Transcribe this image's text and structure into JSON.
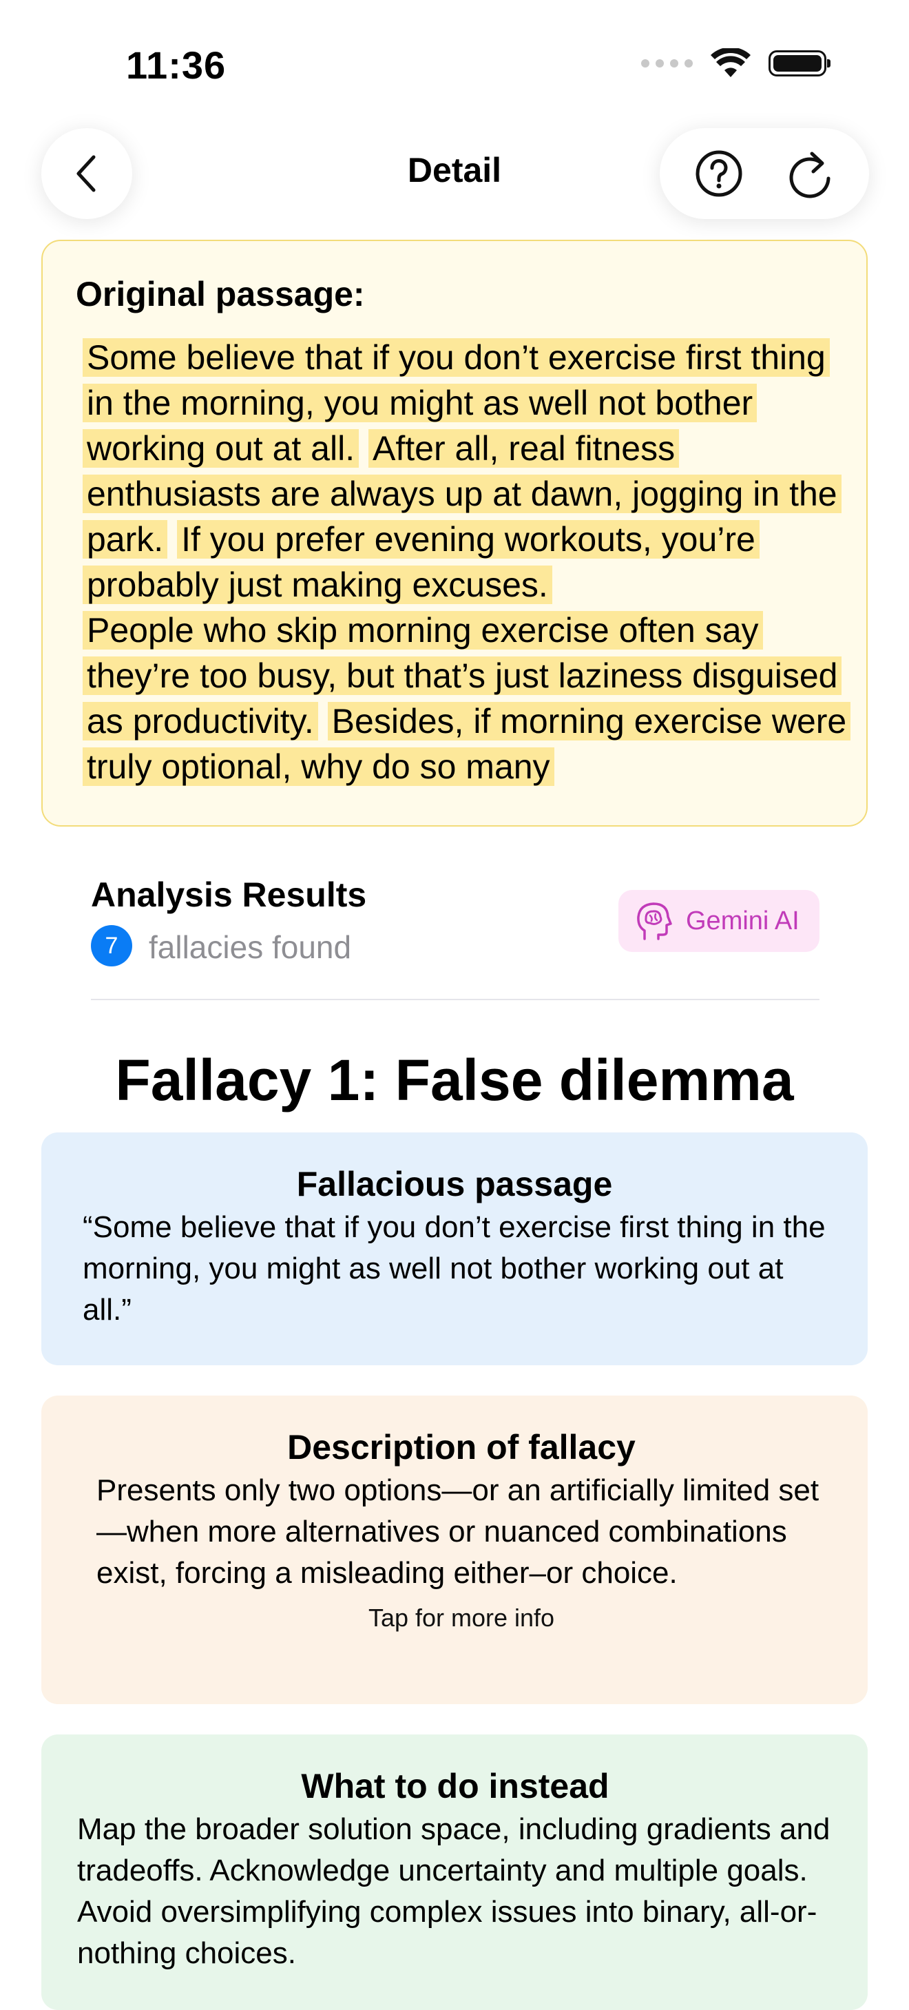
{
  "status_bar": {
    "time": "11:36"
  },
  "nav": {
    "title": "Detail"
  },
  "original": {
    "label": "Original passage:",
    "segments": [
      "Some believe that if you don’t exercise first thing in the morning, you might as well not bother working out at all.",
      "After all, real fitness enthusiasts are always up at dawn, jogging in the park.",
      "If you prefer evening workouts, you’re probably just making excuses.",
      "People who skip morning exercise often say they’re too busy, but that’s just laziness disguised as productivity.",
      "Besides, if morning exercise were truly optional, why do so many"
    ]
  },
  "analysis": {
    "title": "Analysis Results",
    "count": "7",
    "count_label": "fallacies found",
    "engine_label": "Gemini AI"
  },
  "fallacy": {
    "heading": "Fallacy 1: False dilemma",
    "passage_title": "Fallacious passage",
    "passage_text": "“Some believe that if you don’t exercise first thing in the morning, you might as well not bother working out at all.”",
    "description_title": "Description of fallacy",
    "description_text": "Presents only two options—or an artificially limited set—when more alternatives or nuanced combinations exist, forcing a misleading either–or choice.",
    "more_info": "Tap for more info",
    "instead_title": "What to do instead",
    "instead_text": "Map the broader solution space, including gradients and tradeoffs. Acknowledge uncertainty and multiple goals. Avoid oversimplifying complex issues into binary, all-or-nothing choices."
  },
  "icons": {
    "back": "chevron-left-icon",
    "help": "question-circle-icon",
    "refresh": "refresh-icon",
    "engine": "brain-head-icon"
  },
  "colors": {
    "highlight": "#fde89a",
    "badge_blue": "#0a7cf5",
    "gemini_text": "#c13bb9",
    "gemini_bg": "#fde6f7"
  }
}
